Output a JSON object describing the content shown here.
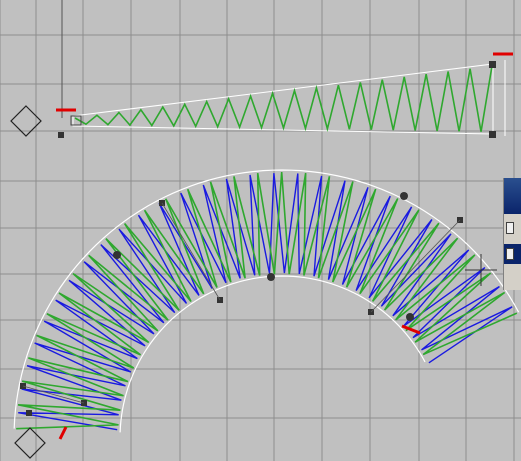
{
  "app": {
    "canvas": {
      "background": "#c0c0c0",
      "grid_color": "#8e8e8e",
      "stitch_green": "#2fa82f",
      "stitch_blue": "#1a1ae0",
      "outline_color": "#ffffff",
      "marker_red": "#e00000",
      "handle_color": "#333333"
    },
    "objects": [
      {
        "name": "straight-taper-column",
        "type": "satin-column",
        "colors": [
          "green"
        ]
      },
      {
        "name": "curved-satin-arc",
        "type": "satin-column",
        "colors": [
          "green",
          "blue"
        ]
      }
    ],
    "tools": [
      "cross-cursor-icon",
      "diamond-anchor-icon"
    ],
    "side_panel": {
      "title_color": "#0a246a",
      "item_label": "",
      "selected_label": ""
    }
  }
}
